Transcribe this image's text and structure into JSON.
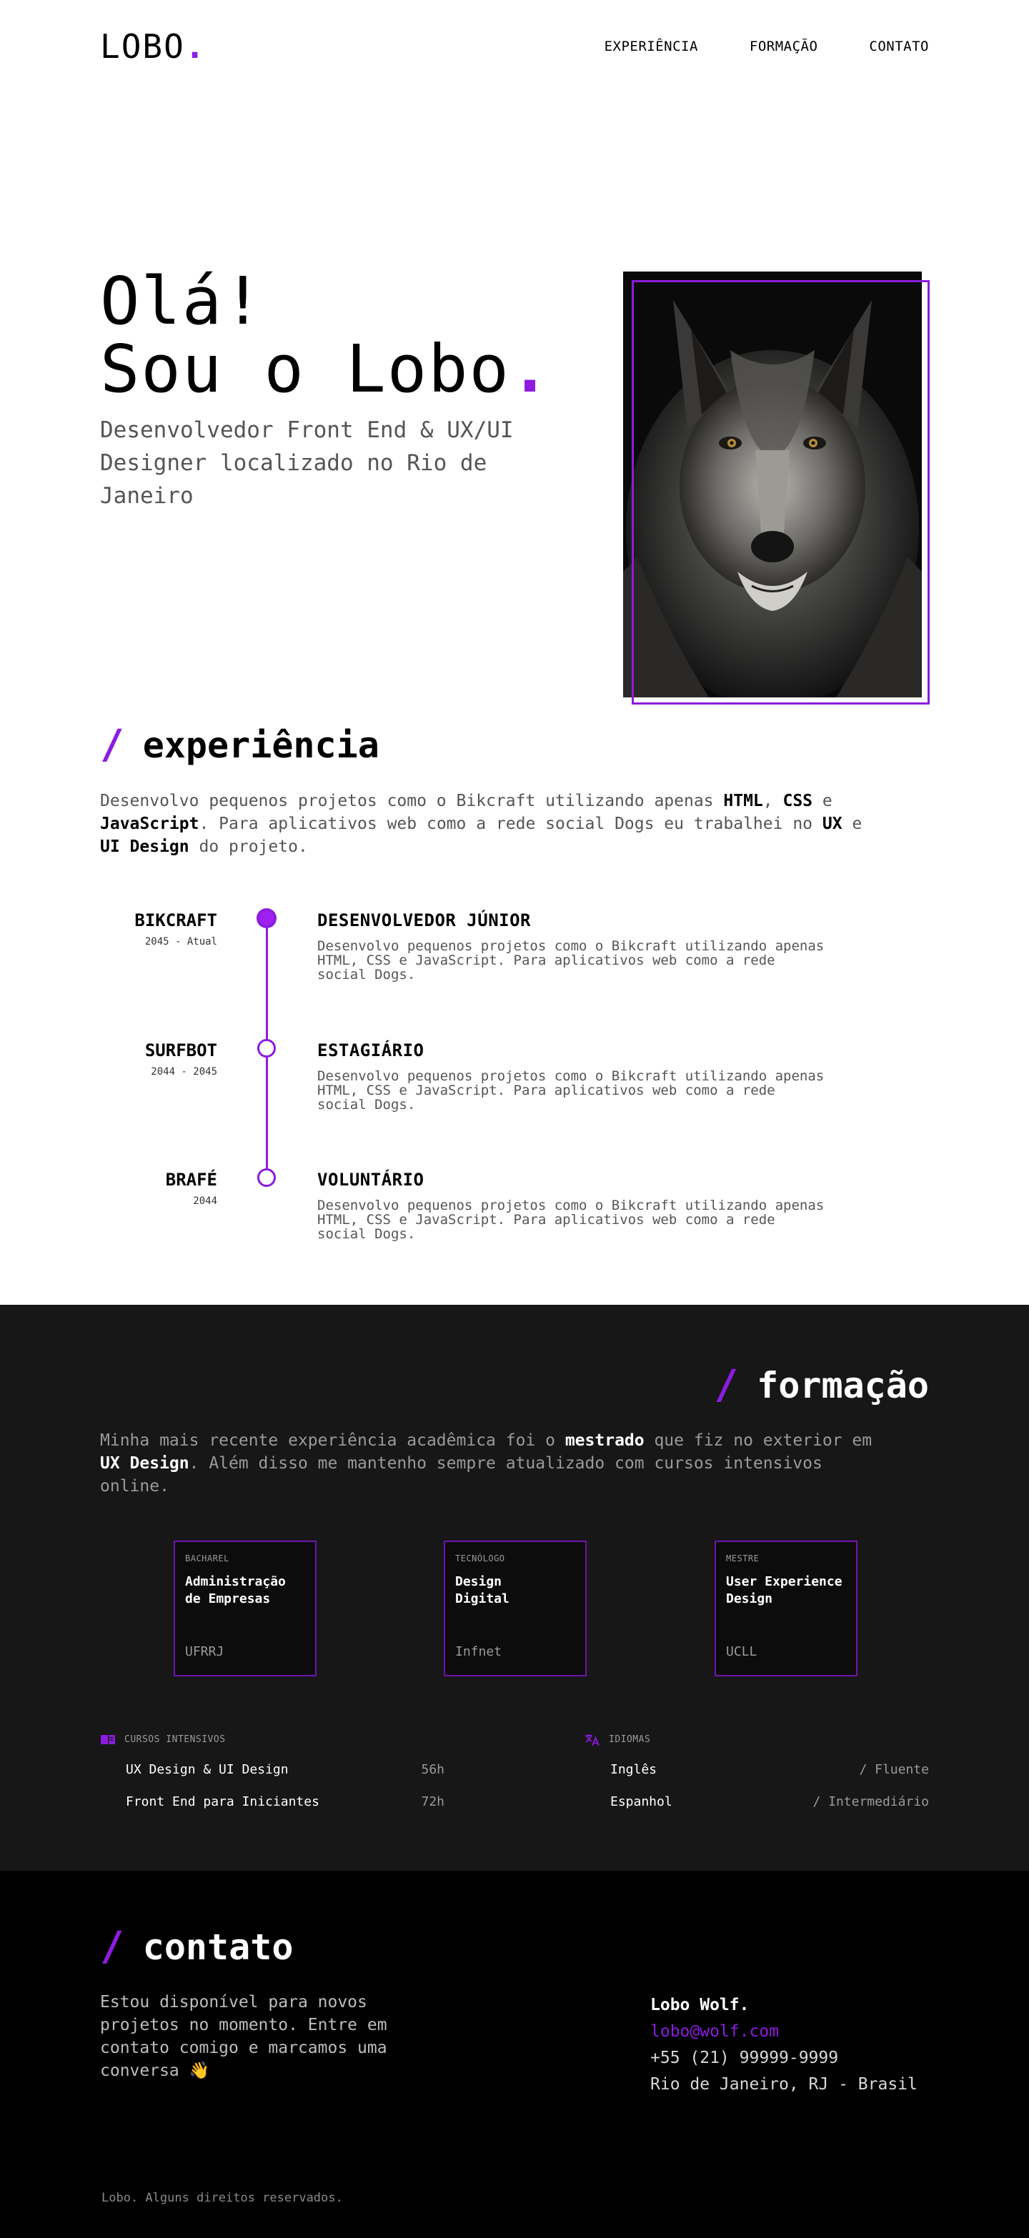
{
  "header": {
    "logo": "LOBO",
    "logo_dot": ".",
    "nav": [
      "EXPERIÊNCIA",
      "FORMAÇÃO",
      "CONTATO"
    ]
  },
  "hero": {
    "title_line1": "Olá!",
    "title_line2": "Sou o Lobo",
    "title_dot": ".",
    "subtitle": "Desenvolvedor Front End & UX/UI Designer localizado no Rio de Janeiro"
  },
  "experience": {
    "slash": "/",
    "title": "experiência",
    "intro_parts": [
      "Desenvolvo pequenos projetos como o Bikcraft utilizando apenas ",
      "HTML",
      ", ",
      "CSS",
      " e ",
      "JavaScript",
      ". Para aplicativos web como a rede social Dogs eu trabalhei no ",
      "UX",
      " e ",
      "UI Design",
      " do projeto."
    ],
    "items": [
      {
        "company": "BIKCRAFT",
        "date": "2045 - Atual",
        "role": "DESENVOLVEDOR JÚNIOR",
        "desc": "Desenvolvo pequenos projetos como o Bikcraft utilizando apenas HTML, CSS e JavaScript. Para aplicativos web como a rede social Dogs."
      },
      {
        "company": "SURFBOT",
        "date": "2044 - 2045",
        "role": "ESTAGIÁRIO",
        "desc": "Desenvolvo pequenos projetos como o Bikcraft utilizando apenas HTML, CSS e JavaScript. Para aplicativos web como a rede social Dogs."
      },
      {
        "company": "BRAFÉ",
        "date": "2044",
        "role": "VOLUNTÁRIO",
        "desc": "Desenvolvo pequenos projetos como o Bikcraft utilizando apenas HTML, CSS e JavaScript. Para aplicativos web como a rede social Dogs."
      }
    ]
  },
  "education": {
    "slash": "/",
    "title": "formação",
    "intro_parts": [
      "Minha mais recente experiência acadêmica foi o ",
      "mestrado",
      " que fiz no exterior em ",
      "UX Design",
      ". Além disso me mantenho sempre atualizado com cursos intensivos online."
    ],
    "cards": [
      {
        "level": "BACHAREL",
        "title": "Administração de Empresas",
        "institution": "UFRRJ"
      },
      {
        "level": "TECNÓLOGO",
        "title": "Design Digital",
        "institution": "Infnet"
      },
      {
        "level": "MESTRE",
        "title": "User Experience Design",
        "institution": "UCLL"
      }
    ],
    "courses": {
      "heading": "CURSOS INTENSIVOS",
      "rows": [
        {
          "name": "UX Design & UI Design",
          "value": "56h"
        },
        {
          "name": "Front End para Iniciantes",
          "value": "72h"
        }
      ]
    },
    "languages": {
      "heading": "IDIOMAS",
      "rows": [
        {
          "name": "Inglês",
          "value": "/ Fluente"
        },
        {
          "name": "Espanhol",
          "value": "/ Intermediário"
        }
      ]
    }
  },
  "contact": {
    "slash": "/",
    "title": "contato",
    "text": "Estou disponível para novos projetos no momento. Entre em contato comigo e marcamos uma conversa 👋",
    "name": "Lobo Wolf.",
    "email": "lobo@wolf.com",
    "phone": "+55 (21) 99999-9999",
    "location": "Rio de Janeiro, RJ - Brasil",
    "footer": "Lobo. Alguns direitos reservados."
  },
  "colors": {
    "accent": "#8c1cde",
    "dark_section": "#171717",
    "black": "#000000"
  }
}
